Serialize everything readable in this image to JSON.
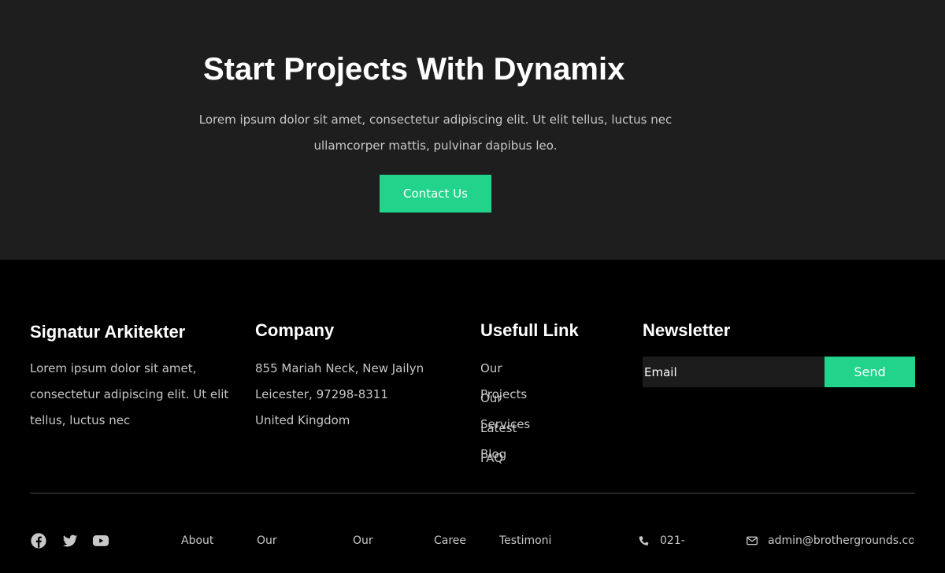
{
  "cta": {
    "title": "Start Projects With Dynamix",
    "text": "Lorem ipsum dolor sit amet, consectetur adipiscing elit. Ut elit tellus, luctus nec ullamcorper mattis, pulvinar dapibus leo.",
    "button_label": "Contact Us"
  },
  "footer": {
    "about": {
      "title": "Signatur Arkitekter",
      "lines": [
        "Lorem ipsum dolor sit amet,",
        "consectetur adipiscing elit. Ut elit",
        "tellus, luctus nec"
      ]
    },
    "company": {
      "title": "Company",
      "lines": [
        "855 Mariah Neck, New Jailyn",
        "Leicester, 97298-8311",
        "United Kingdom"
      ]
    },
    "useful": {
      "title": "Usefull Link",
      "links": [
        "Our Projects",
        "Our Services",
        "Latest Blog",
        "FAQ"
      ]
    },
    "newsletter": {
      "title": "Newsletter",
      "email_placeholder": "Email",
      "send_label": "Send"
    }
  },
  "bottom": {
    "social_icons": [
      "facebook-icon",
      "twitter-icon",
      "youtube-icon"
    ],
    "links": [
      "About",
      "Our",
      "Our",
      "Caree",
      "Testimoni"
    ],
    "phone": "021-",
    "email": "admin@brothergrounds.co"
  },
  "colors": {
    "accent": "#22d38b",
    "cta_background": "#1e1e1e",
    "footer_background": "#000000",
    "muted_text": "#c8c8c8"
  }
}
